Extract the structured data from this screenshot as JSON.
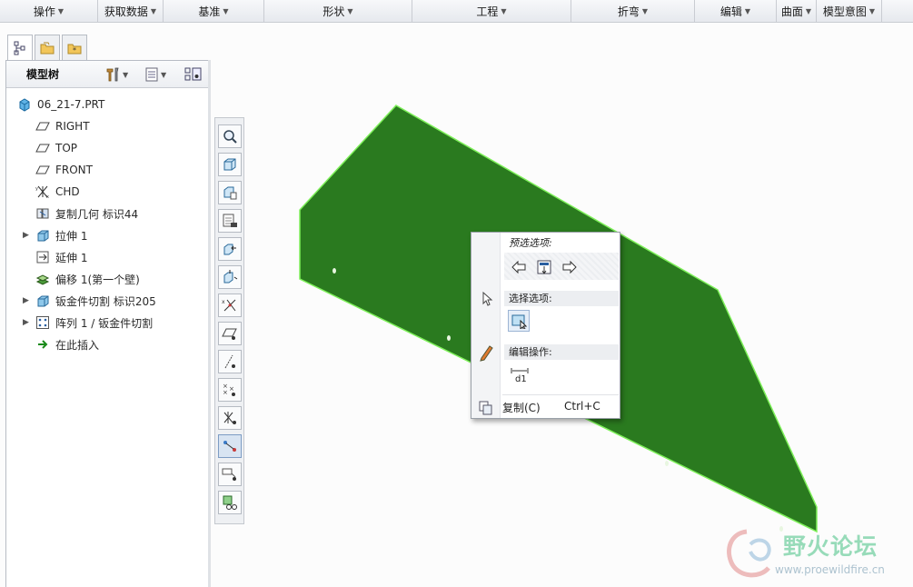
{
  "ribbon": {
    "groups": [
      {
        "label": "操作"
      },
      {
        "label": "获取数据"
      },
      {
        "label": "基准"
      },
      {
        "label": "形状"
      },
      {
        "label": "工程"
      },
      {
        "label": "折弯"
      },
      {
        "label": "编辑"
      },
      {
        "label": "曲面"
      },
      {
        "label": "模型意图"
      }
    ]
  },
  "model_tree": {
    "title": "模型树",
    "nodes": [
      {
        "label": "06_21-7.PRT",
        "icon": "part-icon"
      },
      {
        "label": "RIGHT",
        "icon": "datum-plane-icon"
      },
      {
        "label": "TOP",
        "icon": "datum-plane-icon"
      },
      {
        "label": "FRONT",
        "icon": "datum-plane-icon"
      },
      {
        "label": "CHD",
        "icon": "coordinate-system-icon"
      },
      {
        "label": "复制几何 标识44",
        "icon": "copy-geometry-icon"
      },
      {
        "label": "拉伸 1",
        "icon": "extrude-icon",
        "expandable": true
      },
      {
        "label": "延伸 1",
        "icon": "extend-icon"
      },
      {
        "label": "偏移 1(第一个壁)",
        "icon": "offset-wall-icon"
      },
      {
        "label": "钣金件切割 标识205",
        "icon": "sheetmetal-cut-icon",
        "expandable": true
      },
      {
        "label": "阵列 1 / 钣金件切割",
        "icon": "pattern-icon",
        "expandable": true
      },
      {
        "label": "在此插入",
        "icon": "insert-here-arrow-icon"
      }
    ]
  },
  "popup": {
    "preselect_title": "预选选项:",
    "select_title": "选择选项:",
    "edit_title": "编辑操作:",
    "copy_label": "复制(C)",
    "copy_shortcut": "Ctrl+C"
  },
  "watermark": {
    "text_cn": "野火论坛",
    "url": "www.proewildfire.cn"
  },
  "colors": {
    "surface": "#2a7a1f",
    "surface_edge": "#7ef05a",
    "watermark_text": "#7fd3a9"
  }
}
